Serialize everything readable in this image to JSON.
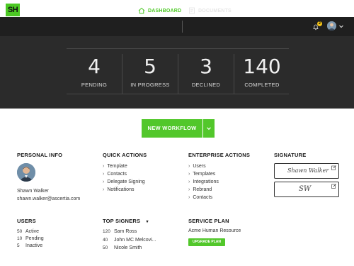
{
  "nav": {
    "logo": "SH",
    "tab_dashboard": "DASHBOARD",
    "tab_documents": "DOCUMENTS",
    "notification_count": "2"
  },
  "stats": [
    {
      "value": "4",
      "label": "PENDING"
    },
    {
      "value": "5",
      "label": "IN PROGRESS"
    },
    {
      "value": "3",
      "label": "DECLINED"
    },
    {
      "value": "140",
      "label": "COMPLETED"
    }
  ],
  "workflow_button": "NEW WORKFLOW",
  "personal_info": {
    "title": "PERSONAL INFO",
    "name": "Shawn Walker",
    "email": "shawn.walker@ascertia.com"
  },
  "quick_actions": {
    "title": "QUICK ACTIONS",
    "items": [
      "Template",
      "Contacts",
      "Delegate Signing",
      "Notifications"
    ]
  },
  "enterprise_actions": {
    "title": "ENTERPRISE ACTIONS",
    "items": [
      "Users",
      "Templates",
      "Integrations",
      "Rebrand",
      "Contacts"
    ]
  },
  "signature": {
    "title": "SIGNATURE",
    "signature_text": "Shawn Walker",
    "initials_text": "SW"
  },
  "users": {
    "title": "USERS",
    "rows": [
      {
        "count": "50",
        "label": "Active"
      },
      {
        "count": "10",
        "label": "Pending"
      },
      {
        "count": "5",
        "label": "Inactive"
      }
    ]
  },
  "top_signers": {
    "title": "TOP SIGNERS",
    "rows": [
      {
        "count": "120",
        "name": "Sam Ross"
      },
      {
        "count": "40",
        "name": "John MC Melcovi..."
      },
      {
        "count": "50",
        "name": "Nicole Smith"
      }
    ]
  },
  "service_plan": {
    "title": "SERVICE PLAN",
    "plan_name": "Acme Human Resource",
    "upgrade_label": "UPGRADE PLAN"
  },
  "colors": {
    "accent": "#52c72b",
    "nav_bg": "#1f1f1f",
    "stats_bg": "#2b2b2b",
    "badge": "#f5c518"
  }
}
